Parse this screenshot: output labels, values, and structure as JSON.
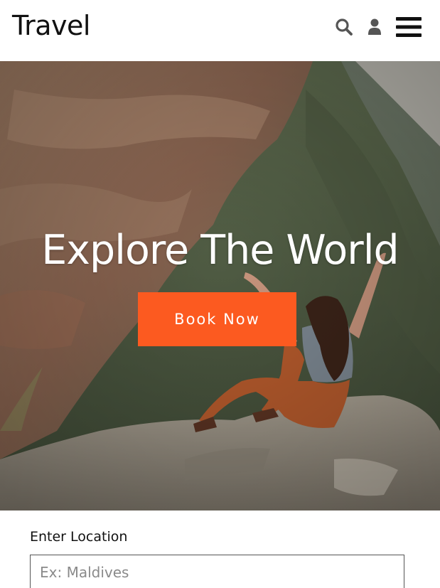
{
  "header": {
    "logo": "Travel",
    "icons": [
      "search-icon",
      "user-icon",
      "menu-icon"
    ]
  },
  "hero": {
    "title": "Explore The World",
    "button_label": "Book Now"
  },
  "booking_form": {
    "location_label": "Enter Location",
    "location_placeholder": "Ex: Maldives",
    "location_value": ""
  },
  "colors": {
    "accent": "#fc5a20",
    "header_bg": "#ffffff",
    "text": "#111111"
  }
}
